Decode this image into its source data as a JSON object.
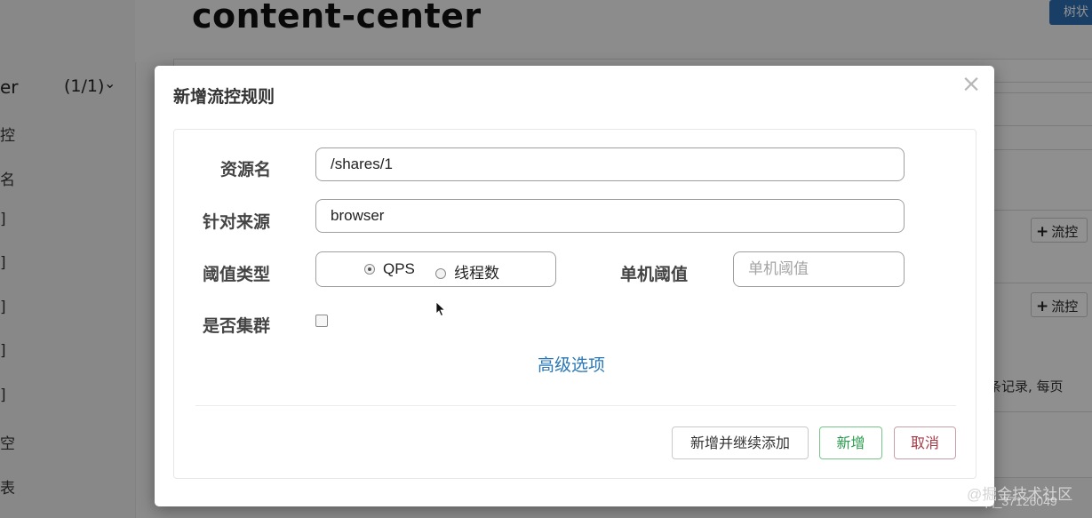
{
  "background": {
    "app_name": "er",
    "app_count": "(1/1)",
    "sidebar_items": [
      "控",
      "名",
      "]",
      "]",
      "]",
      "]",
      "]",
      "空",
      "表"
    ],
    "page_title": "content-center",
    "tree_button": "树状",
    "flow_button": "流控",
    "records_text": "条记录, 每页"
  },
  "modal": {
    "title": "新增流控规则",
    "close": "×",
    "form": {
      "resource_label": "资源名",
      "resource_value": "/shares/1",
      "origin_label": "针对来源",
      "origin_value": "browser",
      "threshold_type_label": "阈值类型",
      "threshold_type_options": [
        {
          "label": "QPS",
          "selected": true
        },
        {
          "label": "线程数",
          "selected": false
        }
      ],
      "single_threshold_label": "单机阈值",
      "single_threshold_placeholder": "单机阈值",
      "cluster_label": "是否集群",
      "cluster_checked": false,
      "advanced_link": "高级选项"
    },
    "buttons": {
      "add_continue": "新增并继续添加",
      "add": "新增",
      "cancel": "取消"
    }
  },
  "watermark": {
    "text": "@掘金技术社区",
    "site": "qq_37126049",
    "url": "https://blog.csdn"
  },
  "colors": {
    "link": "#2a77b6",
    "add_button": "#2a9a4e",
    "cancel_button": "#a63946",
    "tree_button_bg": "#2f6fb5"
  }
}
